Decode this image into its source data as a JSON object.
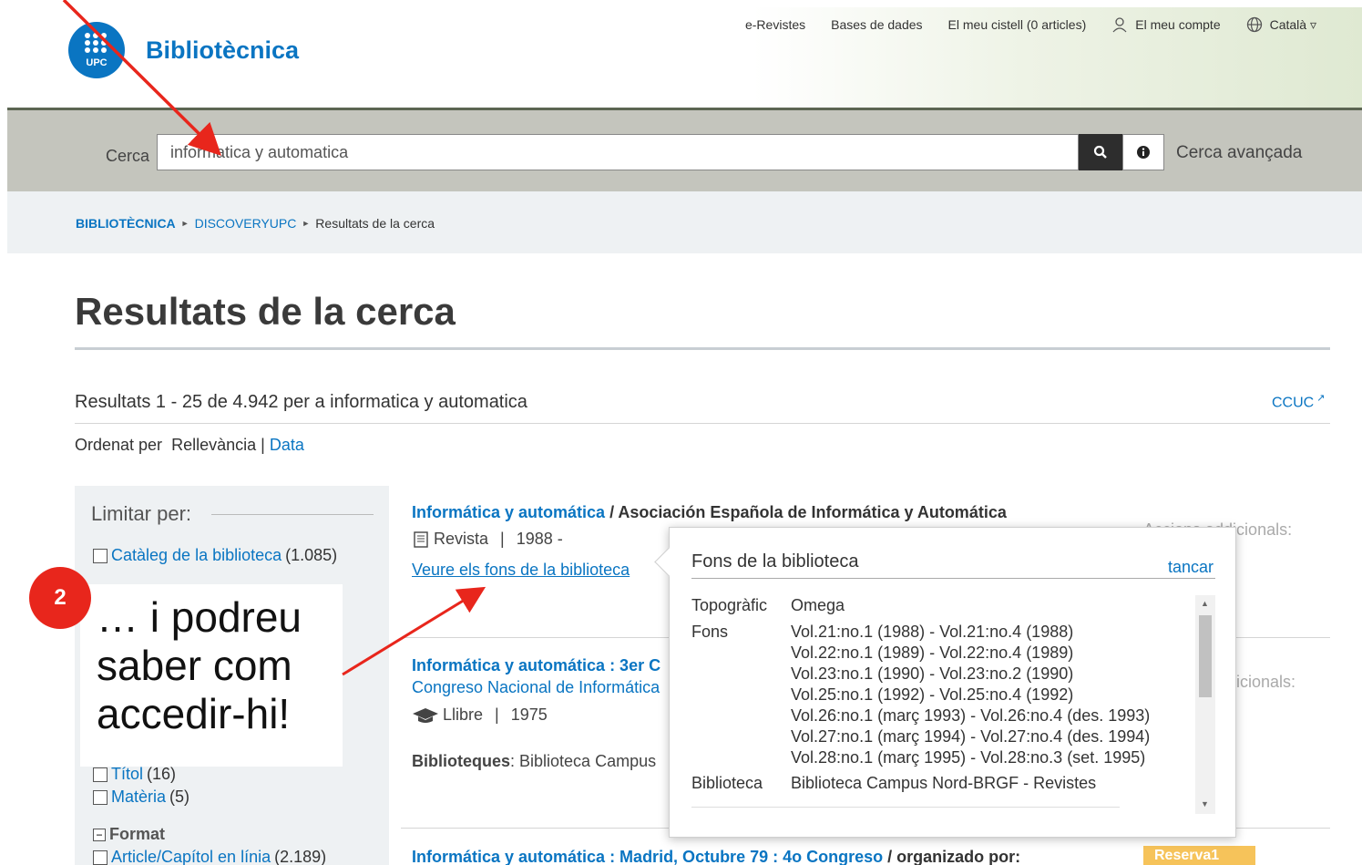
{
  "header": {
    "site_title": "Bibliotècnica",
    "logo_text": "UPC",
    "nav": {
      "erevistes": "e-Revistes",
      "bases": "Bases de dades",
      "cistell": "El meu cistell (0 articles)",
      "compte": "El meu compte",
      "idioma": "Català ▿"
    }
  },
  "search": {
    "label": "Cerca",
    "value": "informatica y automatica",
    "advanced": "Cerca avançada"
  },
  "breadcrumb": {
    "home": "BIBLIOTÈCNICA",
    "discovery": "DISCOVERYUPC",
    "current": "Resultats de la cerca"
  },
  "page": {
    "title": "Resultats de la cerca",
    "summary": "Resultats 1 - 25 de 4.942 per a informatica y automatica",
    "ccuc": "CCUC",
    "sort_label": "Ordenat per",
    "sort_relevance": "Rellevància",
    "sort_sep": "|",
    "sort_date": "Data"
  },
  "facets": {
    "heading": "Limitar per:",
    "items": [
      {
        "label": "Catàleg de la biblioteca",
        "count": "(1.085)"
      },
      {
        "label": "Títol",
        "count": "(16)"
      },
      {
        "label": "Matèria",
        "count": "(5)"
      }
    ],
    "format_heading": "Format",
    "format_items": [
      {
        "label": "Article/Capítol en línia",
        "count": "(2.189)"
      }
    ]
  },
  "results": [
    {
      "title": "Informática y automática",
      "author": " / Asociación Española de Informática y Automática",
      "type": "Revista",
      "sep": "|",
      "year": "1988 -",
      "holdings_link": "Veure els fons de la biblioteca",
      "actions": "Accions addicionals:"
    },
    {
      "title": "Informática y automática : 3er C",
      "subtitle": "Congreso Nacional de Informática",
      "type": "Llibre",
      "sep": "|",
      "year": "1975",
      "libraries_label": "Biblioteques",
      "libraries_value": ": Biblioteca Campus",
      "actions": "icionals:"
    },
    {
      "title": "Informática y automática : Madrid, Octubre 79 : 4o Congreso",
      "author": " / organizado por:",
      "reserve": "Reserva1"
    }
  ],
  "popup": {
    "title": "Fons de la biblioteca",
    "close": "tancar",
    "topografic_label": "Topogràfic",
    "topografic_value": "Omega",
    "fons_label": "Fons",
    "fons_values": [
      "Vol.21:no.1 (1988) - Vol.21:no.4 (1988)",
      "Vol.22:no.1 (1989) - Vol.22:no.4 (1989)",
      "Vol.23:no.1 (1990) - Vol.23:no.2 (1990)",
      "Vol.25:no.1 (1992) - Vol.25:no.4 (1992)",
      "Vol.26:no.1 (març 1993) - Vol.26:no.4 (des. 1993)",
      "Vol.27:no.1 (març 1994) - Vol.27:no.4 (des. 1994)",
      "Vol.28:no.1 (març 1995) - Vol.28:no.3 (set. 1995)"
    ],
    "biblioteca_label": "Biblioteca",
    "biblioteca_value": "Biblioteca Campus Nord-BRGF - Revistes"
  },
  "annotation": {
    "badge": "2",
    "callout_lines": [
      "… i podreu",
      "saber com",
      "accedir-hi!"
    ],
    "color": "#e8261c"
  }
}
